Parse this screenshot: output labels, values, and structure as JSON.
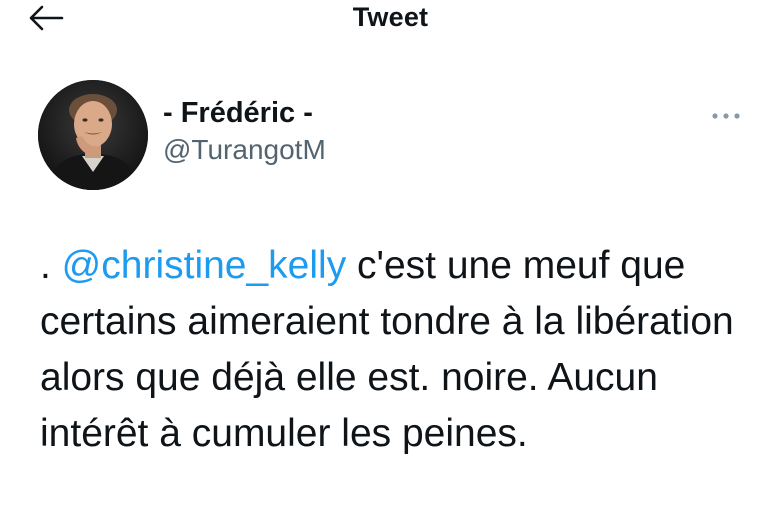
{
  "header": {
    "title": "Tweet",
    "back_icon": "arrow-left-icon"
  },
  "author": {
    "display_name": "- Frédéric -",
    "handle": "@TurangotM",
    "avatar_icon": "profile-photo"
  },
  "more_icon": "more-horizontal-icon",
  "tweet": {
    "text_before": ". ",
    "mention": "@christine_kelly",
    "text_after": " c'est une meuf que certains aimeraient tondre à la libération alors que déjà elle est. noire. Aucun intérêt à cumuler les peines."
  },
  "colors": {
    "link": "#1d9bf0",
    "text": "#0f1419",
    "secondary_text": "#536471",
    "background": "#ffffff"
  }
}
